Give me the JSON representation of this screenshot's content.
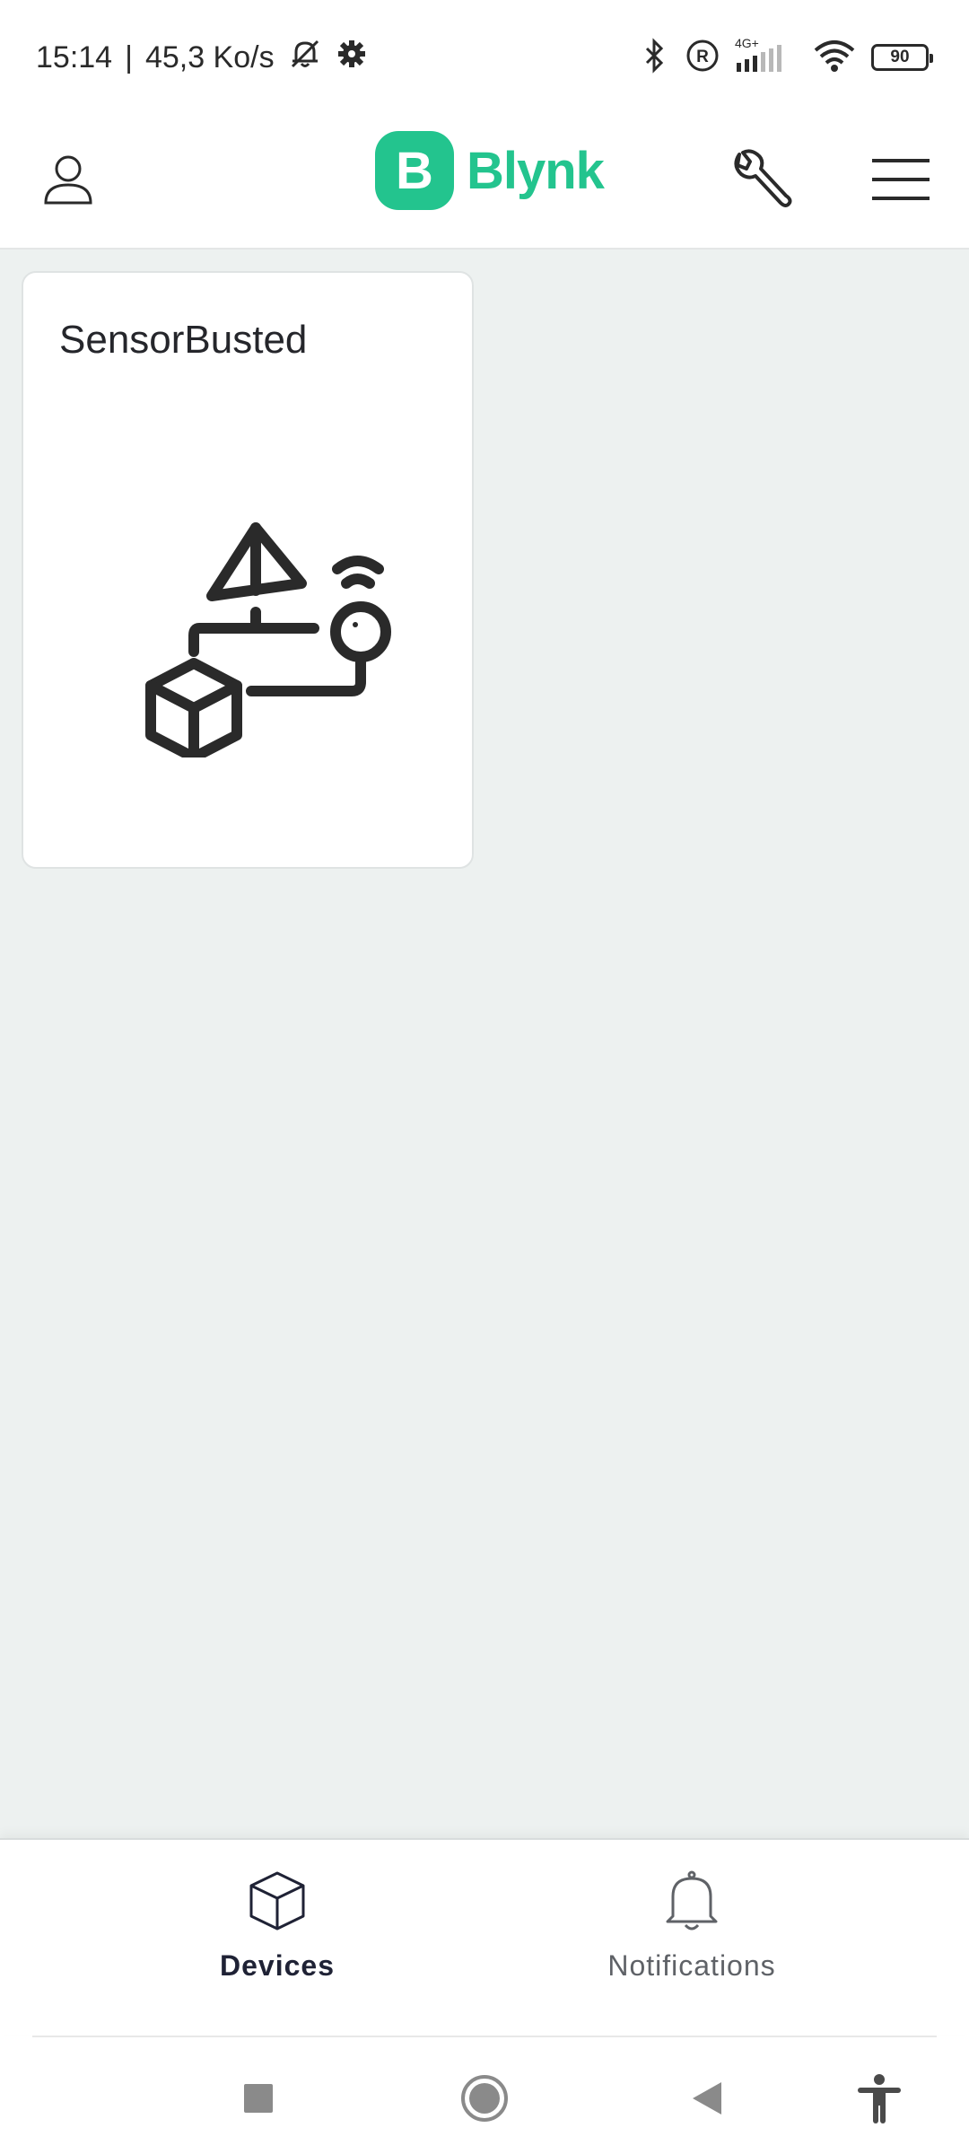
{
  "status_bar": {
    "time": "15:14",
    "separator": "|",
    "network_speed": "45,3 Ko/s",
    "network_type": "4G+",
    "battery_level": "90",
    "icons": [
      "bell-off-icon",
      "settings-icon",
      "bluetooth-icon",
      "registered-icon",
      "signal-icon",
      "wifi-icon",
      "battery-icon"
    ]
  },
  "header": {
    "logo_letter": "B",
    "logo_text": "Blynk",
    "brand_color": "#23c48e",
    "icons": [
      "user-icon",
      "wrench-icon",
      "menu-icon"
    ]
  },
  "devices": [
    {
      "name": "SensorBusted",
      "icon": "device-template-icon"
    }
  ],
  "bottom_nav": {
    "items": [
      {
        "label": "Devices",
        "icon": "cube-icon",
        "active": true
      },
      {
        "label": "Notifications",
        "icon": "bell-icon",
        "active": false
      }
    ]
  },
  "system_nav": {
    "icons": [
      "recent-apps-icon",
      "home-icon",
      "back-icon",
      "accessibility-icon"
    ]
  }
}
